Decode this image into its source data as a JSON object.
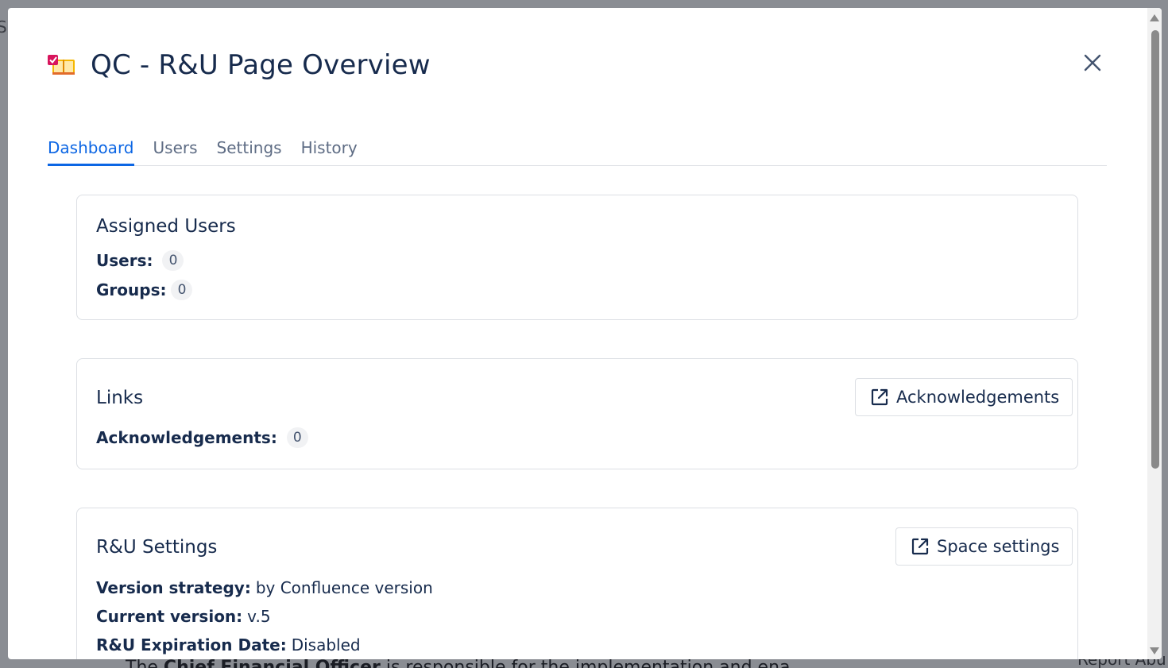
{
  "background": {
    "left_fragment": "S",
    "bottom_text_pre": "The ",
    "bottom_text_bold": "Chief Financial Officer",
    "bottom_text_post": " is responsible for the implementation and ena",
    "bottom_right_fragment": "Report Abu"
  },
  "modal": {
    "title": "QC - R&U Page Overview",
    "app_icon": "book-checklist-icon",
    "close_icon": "close-icon"
  },
  "tabs": [
    {
      "label": "Dashboard",
      "active": true
    },
    {
      "label": "Users",
      "active": false
    },
    {
      "label": "Settings",
      "active": false
    },
    {
      "label": "History",
      "active": false
    }
  ],
  "assigned_users": {
    "title": "Assigned Users",
    "users_label": "Users:",
    "users_count": "0",
    "groups_label": "Groups:",
    "groups_count": "0"
  },
  "links": {
    "title": "Links",
    "button_label": "Acknowledgements",
    "button_icon": "external-link-icon",
    "ack_label": "Acknowledgements:",
    "ack_count": "0"
  },
  "ru_settings": {
    "title": "R&U Settings",
    "button_label": "Space settings",
    "button_icon": "external-link-icon",
    "version_strategy_label": "Version strategy:",
    "version_strategy_value": "by Confluence version",
    "current_version_label": "Current version:",
    "current_version_value": "v.5",
    "expiration_label": "R&U Expiration Date:",
    "expiration_value": "Disabled"
  },
  "colors": {
    "accent": "#0c66e4",
    "text": "#172b4d",
    "muted": "#5e6c84",
    "overlay": "#8c8f95"
  }
}
